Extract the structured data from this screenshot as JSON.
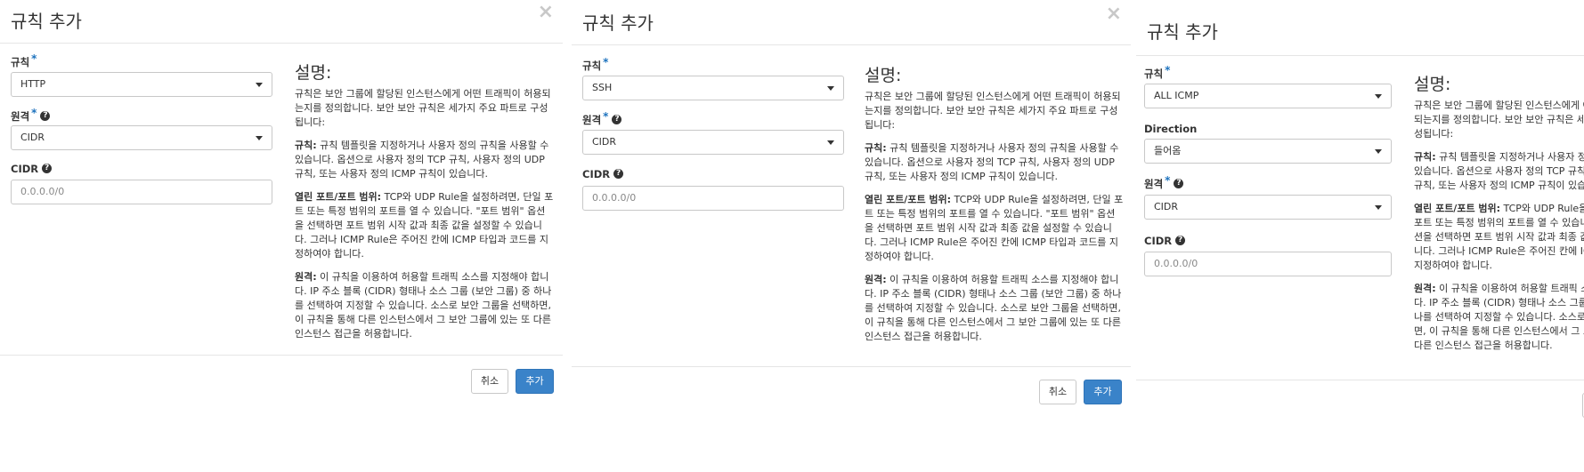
{
  "modal": {
    "title": "규칙 추가",
    "close_glyph": "×",
    "required_mark": "*",
    "help_glyph": "?",
    "cancel_label": "취소",
    "add_label": "추가"
  },
  "labels": {
    "rule": "규칙",
    "direction": "Direction",
    "remote": "원격",
    "cidr": "CIDR"
  },
  "panels": [
    {
      "rule_value": "HTTP",
      "remote_value": "CIDR",
      "cidr_placeholder": "0.0.0.0/0"
    },
    {
      "rule_value": "SSH",
      "remote_value": "CIDR",
      "cidr_placeholder": "0.0.0.0/0"
    },
    {
      "rule_value": "ALL ICMP",
      "direction_value": "들어옴",
      "remote_value": "CIDR",
      "cidr_placeholder": "0.0.0.0/0"
    }
  ],
  "description": {
    "title": "설명:",
    "intro": "규칙은 보안 그룹에 할당된 인스턴스에게 어떤 트래픽이 허용되는지를 정의합니다. 보안 보안 규칙은 세가지 주요 파트로 구성됩니다:",
    "rule_term": "규칙:",
    "rule_text": "규칙 템플릿을 지정하거나 사용자 정의 규칙을 사용할 수 있습니다. 옵션으로 사용자 정의 TCP 규칙, 사용자 정의 UDP 규칙, 또는 사용자 정의 ICMP 규칙이 있습니다.",
    "port_term": "열린 포트/포트 범위:",
    "port_text": "TCP와 UDP Rule을 설정하려면, 단일 포트 또는 특정 범위의 포트를 열 수 있습니다. \"포트 범위\" 옵션을 선택하면 포트 범위 시작 값과 최종 값을 설정할 수 있습니다. 그러나 ICMP Rule은 주어진 칸에 ICMP 타입과 코드를 지정하여야 합니다.",
    "remote_term": "원격:",
    "remote_text": "이 규칙을 이용하여 허용할 트래픽 소스를 지정해야 합니다. IP 주소 블록 (CIDR) 형태나 소스 그룹 (보안 그룹) 중 하나를 선택하여 지정할 수 있습니다. 소스로 보안 그룹을 선택하면, 이 규칙을 통해 다른 인스턴스에서 그 보안 그룹에 있는 또 다른 인스턴스 접근을 허용합니다."
  }
}
